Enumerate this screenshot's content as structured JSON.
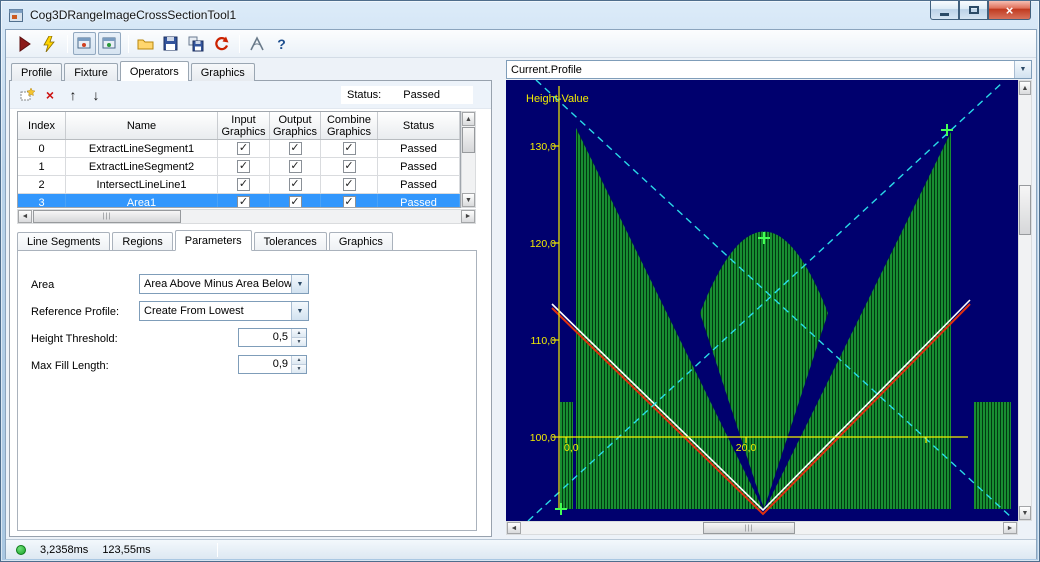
{
  "window": {
    "title": "Cog3DRangeImageCrossSectionTool1"
  },
  "tabs": {
    "items": [
      "Profile",
      "Fixture",
      "Operators",
      "Graphics"
    ],
    "active": "Operators"
  },
  "operators_toolbar": {
    "status_label": "Status:",
    "status_value": "Passed"
  },
  "table": {
    "columns": [
      {
        "l1": "Index",
        "l2": ""
      },
      {
        "l1": "Name",
        "l2": ""
      },
      {
        "l1": "Input",
        "l2": "Graphics"
      },
      {
        "l1": "Output",
        "l2": "Graphics"
      },
      {
        "l1": "Combine",
        "l2": "Graphics"
      },
      {
        "l1": "Status",
        "l2": ""
      }
    ],
    "rows": [
      {
        "index": "0",
        "name": "ExtractLineSegment1",
        "input": "✓",
        "output": "✓",
        "combine": "✓",
        "status": "Passed"
      },
      {
        "index": "1",
        "name": "ExtractLineSegment2",
        "input": "✓",
        "output": "✓",
        "combine": "✓",
        "status": "Passed"
      },
      {
        "index": "2",
        "name": "IntersectLineLine1",
        "input": "✓",
        "output": "✓",
        "combine": "✓",
        "status": "Passed"
      },
      {
        "index": "3",
        "name": "Area1",
        "input": "✓",
        "output": "✓",
        "combine": "✓",
        "status": "Passed"
      }
    ]
  },
  "subtabs": {
    "items": [
      "Line Segments",
      "Regions",
      "Parameters",
      "Tolerances",
      "Graphics"
    ],
    "active": "Parameters"
  },
  "parameters": {
    "area_label": "Area",
    "area_value": "Area Above Minus Area Below",
    "reference_label": "Reference Profile:",
    "reference_value": "Create From Lowest",
    "threshold_label": "Height Threshold:",
    "threshold_value": "0,5",
    "fill_label": "Max Fill Length:",
    "fill_value": "0,9"
  },
  "profile_panel": {
    "selector_value": "Current.Profile",
    "plot": {
      "axis_label": "Height-Value",
      "y_ticks": [
        "130,0",
        "120,0",
        "110,0",
        "100,0"
      ],
      "x_ticks": [
        "0,0",
        "20,0"
      ],
      "colors": {
        "background": "#00006e",
        "hatch_green": "#21b33f",
        "axis_yellow": "#f2ec00",
        "marker_green": "#44ff55",
        "reference_cyan": "#2adbe8",
        "profile_white": "#ffffff",
        "profile_red": "#e03010"
      }
    }
  },
  "status_bar": {
    "execution_time": "3,2358ms",
    "total_time": "123,55ms"
  },
  "icons": {
    "run": "play-triangle-svg",
    "live_run": "lightning-bolt-svg",
    "open": "folder-svg",
    "save": "floppy-svg",
    "save_as": "floppy-copy-svg",
    "reset": "red-curved-arrow-svg",
    "measure": "caliper-svg",
    "help_glyph": "?",
    "dropdown_arrow": "▼",
    "spin_up": "▲",
    "spin_down": "▼",
    "scroll_left": "◄",
    "scroll_right": "►",
    "scroll_up": "▲",
    "scroll_down": "▼",
    "delete_glyph": "×",
    "move_up": "↑",
    "move_down": "↓",
    "close_glyph": "×",
    "check_glyph": "✓",
    "grip": "|||"
  }
}
